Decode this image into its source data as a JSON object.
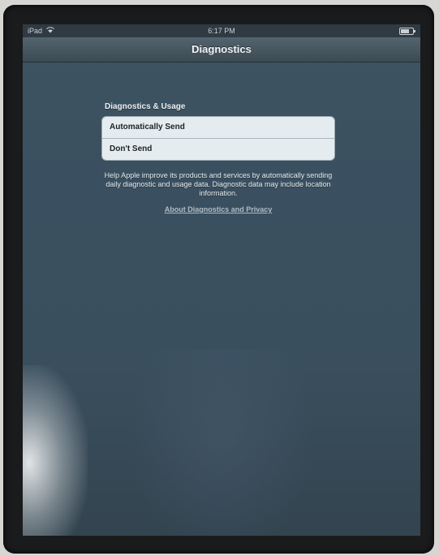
{
  "status_bar": {
    "carrier": "iPad",
    "wifi_icon": "wifi-icon",
    "time": "6:17 PM",
    "battery_icon": "battery-icon",
    "battery_level": 0.7
  },
  "nav": {
    "title": "Diagnostics"
  },
  "diagnostics": {
    "section_header": "Diagnostics & Usage",
    "options": [
      {
        "label": "Automatically Send"
      },
      {
        "label": "Don't Send"
      }
    ],
    "help_text": "Help Apple improve its products and services by automatically sending daily diagnostic and usage data. Diagnostic data may include location information.",
    "link": "About Diagnostics and Privacy"
  }
}
